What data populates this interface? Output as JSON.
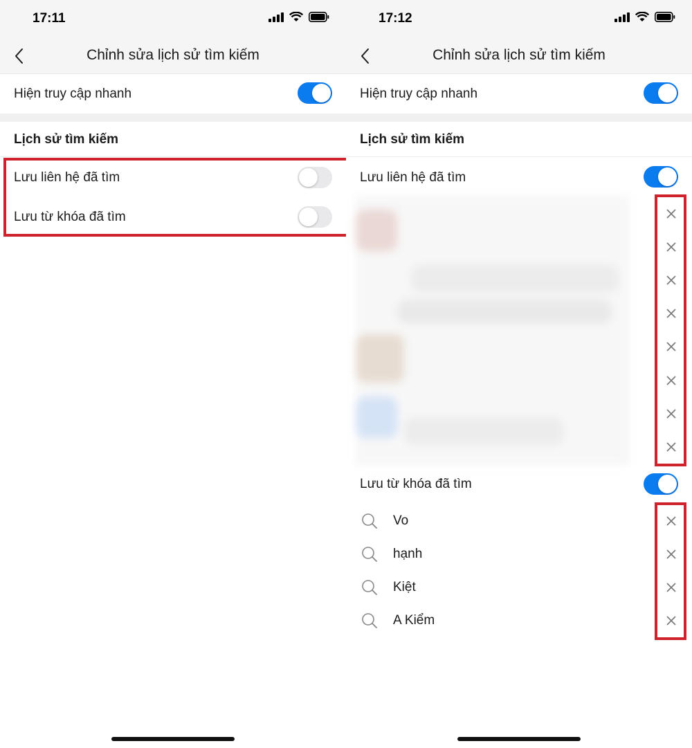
{
  "left": {
    "status": {
      "time": "17:11"
    },
    "nav": {
      "title": "Chỉnh sửa lịch sử tìm kiếm"
    },
    "quick_access": {
      "label": "Hiện truy cập nhanh",
      "enabled": true
    },
    "history_section": {
      "title": "Lịch sử tìm kiếm"
    },
    "save_contacts": {
      "label": "Lưu liên hệ đã tìm",
      "enabled": false
    },
    "save_keywords": {
      "label": "Lưu từ khóa đã tìm",
      "enabled": false
    }
  },
  "right": {
    "status": {
      "time": "17:12"
    },
    "nav": {
      "title": "Chỉnh sửa lịch sử tìm kiếm"
    },
    "quick_access": {
      "label": "Hiện truy cập nhanh",
      "enabled": true
    },
    "history_section": {
      "title": "Lịch sử tìm kiếm"
    },
    "save_contacts": {
      "label": "Lưu liên hệ đã tìm",
      "enabled": true,
      "blurred_item_count": 8
    },
    "save_keywords": {
      "label": "Lưu từ khóa đã tìm",
      "enabled": true
    },
    "keywords": [
      "Vo",
      "hạnh",
      "Kiệt",
      "A Kiểm"
    ]
  },
  "colors": {
    "toggle_on": "#0a7cf0",
    "toggle_off": "#e9e9eb",
    "highlight_box": "#d0222d"
  },
  "icons": {
    "back": "chevron-left-icon",
    "remove": "close-icon",
    "keyword": "search-icon"
  }
}
